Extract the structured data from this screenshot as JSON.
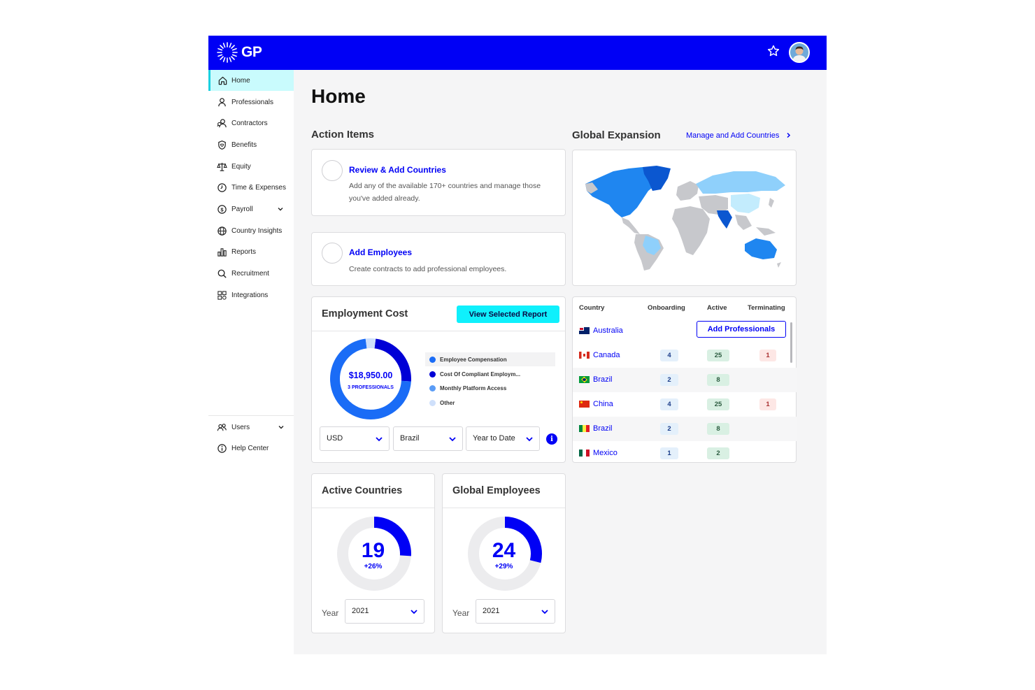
{
  "brand": {
    "name": "GP",
    "primary": "#0000f5",
    "accent": "#0ff0fc"
  },
  "header": {
    "star_icon": "star-icon",
    "avatar": "user-avatar"
  },
  "sidebar": {
    "items": [
      {
        "label": "Home",
        "icon": "home-icon",
        "active": true
      },
      {
        "label": "Professionals",
        "icon": "person-icon"
      },
      {
        "label": "Contractors",
        "icon": "contractors-icon"
      },
      {
        "label": "Benefits",
        "icon": "shield-heart-icon"
      },
      {
        "label": "Equity",
        "icon": "scale-icon"
      },
      {
        "label": "Time & Expenses",
        "icon": "clock-icon"
      },
      {
        "label": "Payroll",
        "icon": "dollar-icon",
        "expandable": true
      },
      {
        "label": "Country Insights",
        "icon": "globe-icon"
      },
      {
        "label": "Reports",
        "icon": "bar-chart-icon"
      },
      {
        "label": "Recruitment",
        "icon": "search-icon"
      },
      {
        "label": "Integrations",
        "icon": "integrations-icon"
      }
    ],
    "bottom": [
      {
        "label": "Users",
        "icon": "users-icon",
        "expandable": true
      },
      {
        "label": "Help Center",
        "icon": "info-icon"
      }
    ]
  },
  "page": {
    "title": "Home"
  },
  "action_items": {
    "title": "Action Items",
    "items": [
      {
        "title": "Review & Add Countries",
        "desc": "Add any of the available 170+ countries and manage those you've added already."
      },
      {
        "title": "Add Employees",
        "desc": "Create contracts to add professional employees."
      }
    ]
  },
  "global_expansion": {
    "title": "Global Expansion",
    "link": "Manage and Add Countries"
  },
  "employment_cost": {
    "title": "Employment Cost",
    "button": "View Selected Report",
    "amount": "$18,950.00",
    "sub": "3 PROFESSIONALS",
    "legend": [
      {
        "label": "Employee Compensation",
        "color": "#1a6cf6"
      },
      {
        "label": "Cost Of Compliant Employm...",
        "color": "#0000d6"
      },
      {
        "label": "Monthly Platform Access",
        "color": "#5a9cf6"
      },
      {
        "label": "Other",
        "color": "#cfe0fb"
      }
    ],
    "filters": {
      "currency": "USD",
      "country": "Brazil",
      "period": "Year to Date"
    }
  },
  "country_table": {
    "headers": [
      "Country",
      "Onboarding",
      "Active",
      "Terminating"
    ],
    "add_button": "Add Professionals",
    "rows": [
      {
        "country": "Australia",
        "onboarding": "",
        "active": "",
        "terminating": ""
      },
      {
        "country": "Canada",
        "onboarding": "4",
        "active": "25",
        "terminating": "1"
      },
      {
        "country": "Brazil",
        "onboarding": "2",
        "active": "8",
        "terminating": ""
      },
      {
        "country": "China",
        "onboarding": "4",
        "active": "25",
        "terminating": "1"
      },
      {
        "country": "Brazil",
        "onboarding": "2",
        "active": "8",
        "terminating": ""
      },
      {
        "country": "Mexico",
        "onboarding": "1",
        "active": "2",
        "terminating": ""
      }
    ]
  },
  "active_countries": {
    "title": "Active Countries",
    "value": "19",
    "change": "+26%",
    "year_label": "Year",
    "year": "2021",
    "progress": 0.26
  },
  "global_employees": {
    "title": "Global Employees",
    "value": "24",
    "change": "+29%",
    "year_label": "Year",
    "year": "2021",
    "progress": 0.29
  }
}
